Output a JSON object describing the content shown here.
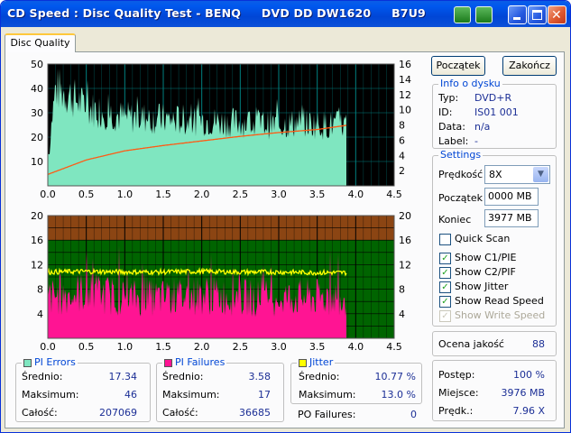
{
  "window": {
    "title": "CD Speed : Disc Quality Test - BENQ     DVD DD DW1620     B7U9"
  },
  "tabs": [
    {
      "label": "Disc Quality",
      "active": true
    }
  ],
  "buttons": {
    "start": "Początek",
    "finish": "Zakończ"
  },
  "disc_info": {
    "header": "Info o dysku",
    "rows": [
      {
        "label": "Typ:",
        "value": "DVD+R"
      },
      {
        "label": "ID:",
        "value": "IS01 001"
      },
      {
        "label": "Data:",
        "value": "n/a"
      },
      {
        "label": "Label:",
        "value": "-"
      }
    ]
  },
  "settings": {
    "header": "Settings",
    "speed_label": "Prędkość",
    "speed_value": "8X",
    "start_label": "Początek",
    "start_value": "0000 MB",
    "end_label": "Koniec",
    "end_value": "3977 MB",
    "checks": [
      {
        "label": "Quick Scan",
        "checked": false,
        "enabled": true
      },
      {
        "label": "Show C1/PIE",
        "checked": true,
        "enabled": true
      },
      {
        "label": "Show C2/PIF",
        "checked": true,
        "enabled": true
      },
      {
        "label": "Show Jitter",
        "checked": true,
        "enabled": true
      },
      {
        "label": "Show Read Speed",
        "checked": true,
        "enabled": true
      },
      {
        "label": "Show Write Speed",
        "checked": true,
        "enabled": false
      }
    ]
  },
  "quality": {
    "label": "Ocena jakość",
    "value": "88"
  },
  "progress": {
    "rows": [
      {
        "label": "Postęp:",
        "value": "100 %"
      },
      {
        "label": "Miejsce:",
        "value": "3976 MB"
      },
      {
        "label": "Prędk.:",
        "value": "7.96 X"
      }
    ]
  },
  "stats": {
    "pi_errors": {
      "header": "PI Errors",
      "color": "#7fe6c0",
      "rows": [
        {
          "label": "Średnio:",
          "value": "17.34"
        },
        {
          "label": "Maksimum:",
          "value": "46"
        },
        {
          "label": "Całość:",
          "value": "207069"
        }
      ]
    },
    "pi_failures": {
      "header": "PI Failures",
      "color": "#ff1493",
      "rows": [
        {
          "label": "Średnio:",
          "value": "3.58"
        },
        {
          "label": "Maksimum:",
          "value": "17"
        },
        {
          "label": "Całość:",
          "value": "36685"
        }
      ]
    },
    "jitter": {
      "header": "Jitter",
      "color": "#ffff00",
      "rows": [
        {
          "label": "Średnio:",
          "value": "10.77 %"
        },
        {
          "label": "Maksimum:",
          "value": "13.0 %"
        }
      ]
    },
    "po_failures": {
      "label": "PO Failures:",
      "value": "0"
    }
  },
  "chart_data": [
    {
      "type": "area",
      "x_ticks": [
        "0.0",
        "0.5",
        "1.0",
        "1.5",
        "2.0",
        "2.5",
        "3.0",
        "3.5",
        "4.0",
        "4.5"
      ],
      "xlim": [
        0,
        4.5
      ],
      "ylim_left": [
        0,
        50
      ],
      "y_ticks_left": [
        "10",
        "20",
        "30",
        "40",
        "50"
      ],
      "ylim_right": [
        0,
        16
      ],
      "y_ticks_right": [
        "2",
        "4",
        "6",
        "8",
        "10",
        "12",
        "14",
        "16"
      ],
      "data_end_x": 3.88,
      "colors": {
        "background": "#000000",
        "grid": "#008080",
        "fill": "#7fe6c0",
        "speed": "#ff5a14"
      },
      "series": [
        {
          "values": [
            [
              0.0,
              13
            ],
            [
              0.1,
              40
            ],
            [
              0.3,
              37
            ],
            [
              0.5,
              32
            ],
            [
              0.8,
              30
            ],
            [
              1.0,
              28
            ],
            [
              1.3,
              28
            ],
            [
              1.6,
              27
            ],
            [
              2.0,
              27
            ],
            [
              2.3,
              26
            ],
            [
              2.6,
              26
            ],
            [
              3.0,
              25
            ],
            [
              3.3,
              26
            ],
            [
              3.6,
              25
            ],
            [
              3.88,
              25
            ]
          ]
        },
        {
          "values": [
            [
              0.0,
              1.5
            ],
            [
              0.5,
              3.4
            ],
            [
              1.0,
              4.6
            ],
            [
              1.5,
              5.3
            ],
            [
              2.0,
              5.9
            ],
            [
              2.5,
              6.5
            ],
            [
              3.0,
              7.0
            ],
            [
              3.5,
              7.4
            ],
            [
              3.88,
              7.95
            ]
          ]
        }
      ]
    },
    {
      "type": "bar",
      "x_ticks": [
        "0.0",
        "0.5",
        "1.0",
        "1.5",
        "2.0",
        "2.5",
        "3.0",
        "3.5",
        "4.0",
        "4.5"
      ],
      "xlim": [
        0,
        4.5
      ],
      "ylim_left": [
        0,
        20
      ],
      "y_ticks_left": [
        "4",
        "8",
        "12",
        "16",
        "20"
      ],
      "ylim_right": [
        0,
        20
      ],
      "y_ticks_right": [
        "4",
        "8",
        "12",
        "16",
        "20"
      ],
      "data_end_x": 3.88,
      "colors": {
        "background_low": "#006400",
        "background_high": "#8b4513",
        "grid": "#000000",
        "fill": "#ff1493",
        "jitter": "#ffff00"
      },
      "series": [
        {
          "values": [
            [
              0.0,
              7
            ],
            [
              0.5,
              8
            ],
            [
              1.0,
              7
            ],
            [
              1.5,
              7
            ],
            [
              2.0,
              7.5
            ],
            [
              2.5,
              7
            ],
            [
              3.0,
              7
            ],
            [
              3.5,
              7
            ],
            [
              3.88,
              7
            ]
          ]
        },
        {
          "values": [
            [
              0.0,
              10.8
            ],
            [
              0.5,
              10.9
            ],
            [
              1.0,
              10.8
            ],
            [
              1.5,
              10.8
            ],
            [
              2.0,
              10.9
            ],
            [
              2.5,
              10.8
            ],
            [
              3.0,
              10.8
            ],
            [
              3.5,
              10.7
            ],
            [
              3.88,
              10.7
            ]
          ]
        }
      ]
    }
  ]
}
